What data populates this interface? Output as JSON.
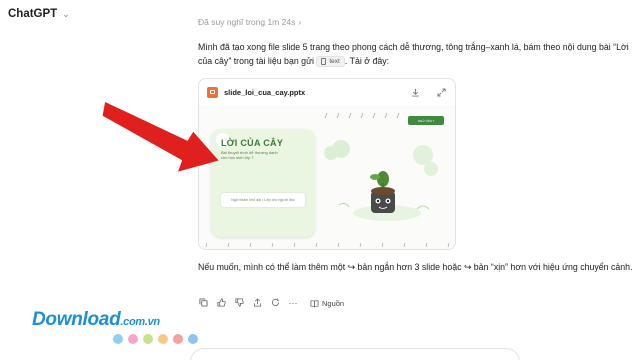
{
  "app": {
    "title": "ChatGPT"
  },
  "thinking": {
    "label": "Đã suy nghĩ trong 1m 24s"
  },
  "message": {
    "intro_before_chip": "Mình đã tạo xong file slide 5 trang theo phong cách dễ thương, tông trắng–xanh lá, bám theo nội dung bài “Lời của cây” trong tài liệu bạn gửi",
    "chip_label": "text",
    "intro_after_chip": ". Tải ở đây:",
    "followup": "Nếu muốn, mình có thể làm thêm một ↪ bản ngắn hơn 3 slide hoặc ↪ bản “xịn” hơn với hiệu ứng chuyển cảnh."
  },
  "attachment": {
    "file_name": "slide_loi_cua_cay.pptx",
    "preview": {
      "title": "LỜI CỦA CÂY",
      "subtitle": "Bài thuyết trình dễ thương dành cho học sinh lớp 7",
      "button_label": "Ngữ nhâm nhỏ đài • Lớp cho người đọc",
      "corner_button_label": "NGỮ VĂN 7"
    }
  },
  "actions": {
    "sources_label": "Nguồn"
  },
  "watermark": {
    "text": "Download",
    "suffix": ".com.vn",
    "dot_colors": [
      "#8fd0f0",
      "#f4a7c8",
      "#c5e38a",
      "#f7c98b",
      "#f7a0a0",
      "#8fc3f0"
    ]
  },
  "colors": {
    "accent_green": "#3f8a3f",
    "ppt_orange": "#e8733a",
    "arrow_red": "#e0201f"
  }
}
